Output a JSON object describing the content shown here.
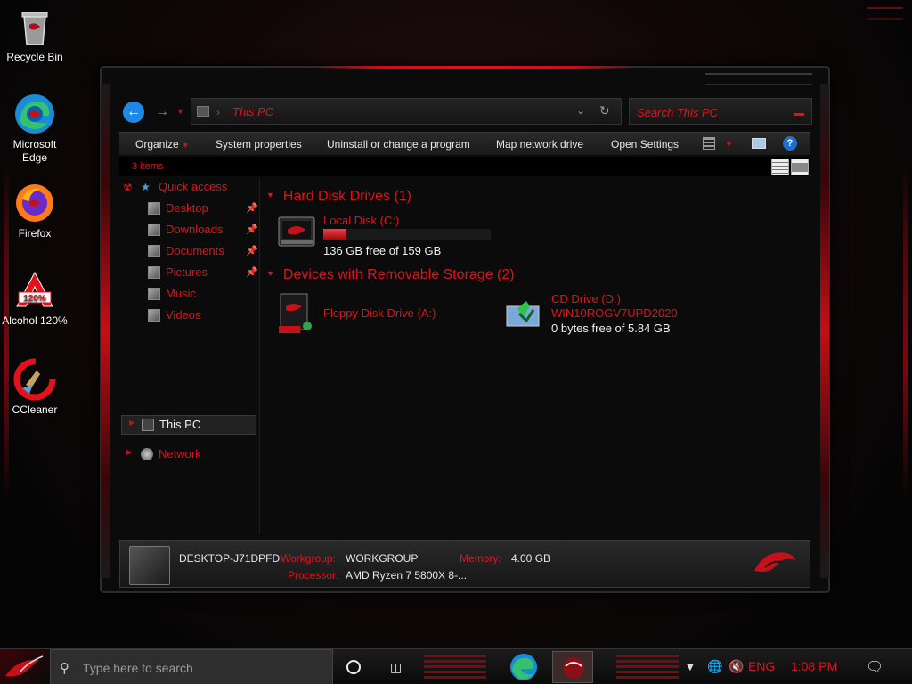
{
  "desktop": {
    "icons": [
      {
        "label": "Recycle Bin"
      },
      {
        "label": "Microsoft Edge"
      },
      {
        "label": "Firefox"
      },
      {
        "label": "Alcohol 120%"
      },
      {
        "label": "CCleaner"
      }
    ]
  },
  "window": {
    "address": {
      "path": "This PC"
    },
    "search": {
      "placeholder": "Search This PC"
    },
    "commands": {
      "organize": "Organize",
      "system_properties": "System properties",
      "uninstall": "Uninstall or change a program",
      "map_drive": "Map network drive",
      "open_settings": "Open Settings"
    },
    "status": {
      "item_count": "3 items"
    },
    "nav": {
      "quick_access": "Quick access",
      "items": [
        {
          "label": "Desktop"
        },
        {
          "label": "Downloads"
        },
        {
          "label": "Documents"
        },
        {
          "label": "Pictures"
        },
        {
          "label": "Music"
        },
        {
          "label": "Videos"
        }
      ],
      "this_pc": "This PC",
      "network": "Network"
    },
    "content": {
      "hdd_group": "Hard Disk Drives (1)",
      "local_disk": {
        "name": "Local Disk (C:)",
        "free": "136 GB free of 159 GB",
        "used_fraction": 0.14
      },
      "removable_group": "Devices with Removable Storage (2)",
      "floppy": {
        "name": "Floppy Disk Drive (A:)"
      },
      "cd": {
        "name": "CD Drive (D:)",
        "label": "WIN10ROGV7UPD2020",
        "free": "0 bytes free of 5.84 GB"
      }
    },
    "details": {
      "computer_name": "DESKTOP-J71DPFD",
      "workgroup_key": "Workgroup:",
      "workgroup_val": "WORKGROUP",
      "memory_key": "Memory:",
      "memory_val": "4.00 GB",
      "processor_key": "Processor:",
      "processor_val": "AMD Ryzen 7 5800X 8-..."
    }
  },
  "taskbar": {
    "search_placeholder": "Type here to search",
    "language": "ENG",
    "time": "1:08 PM"
  },
  "colors": {
    "accent_red": "#e0121c",
    "link_blue": "#1e88e5"
  }
}
